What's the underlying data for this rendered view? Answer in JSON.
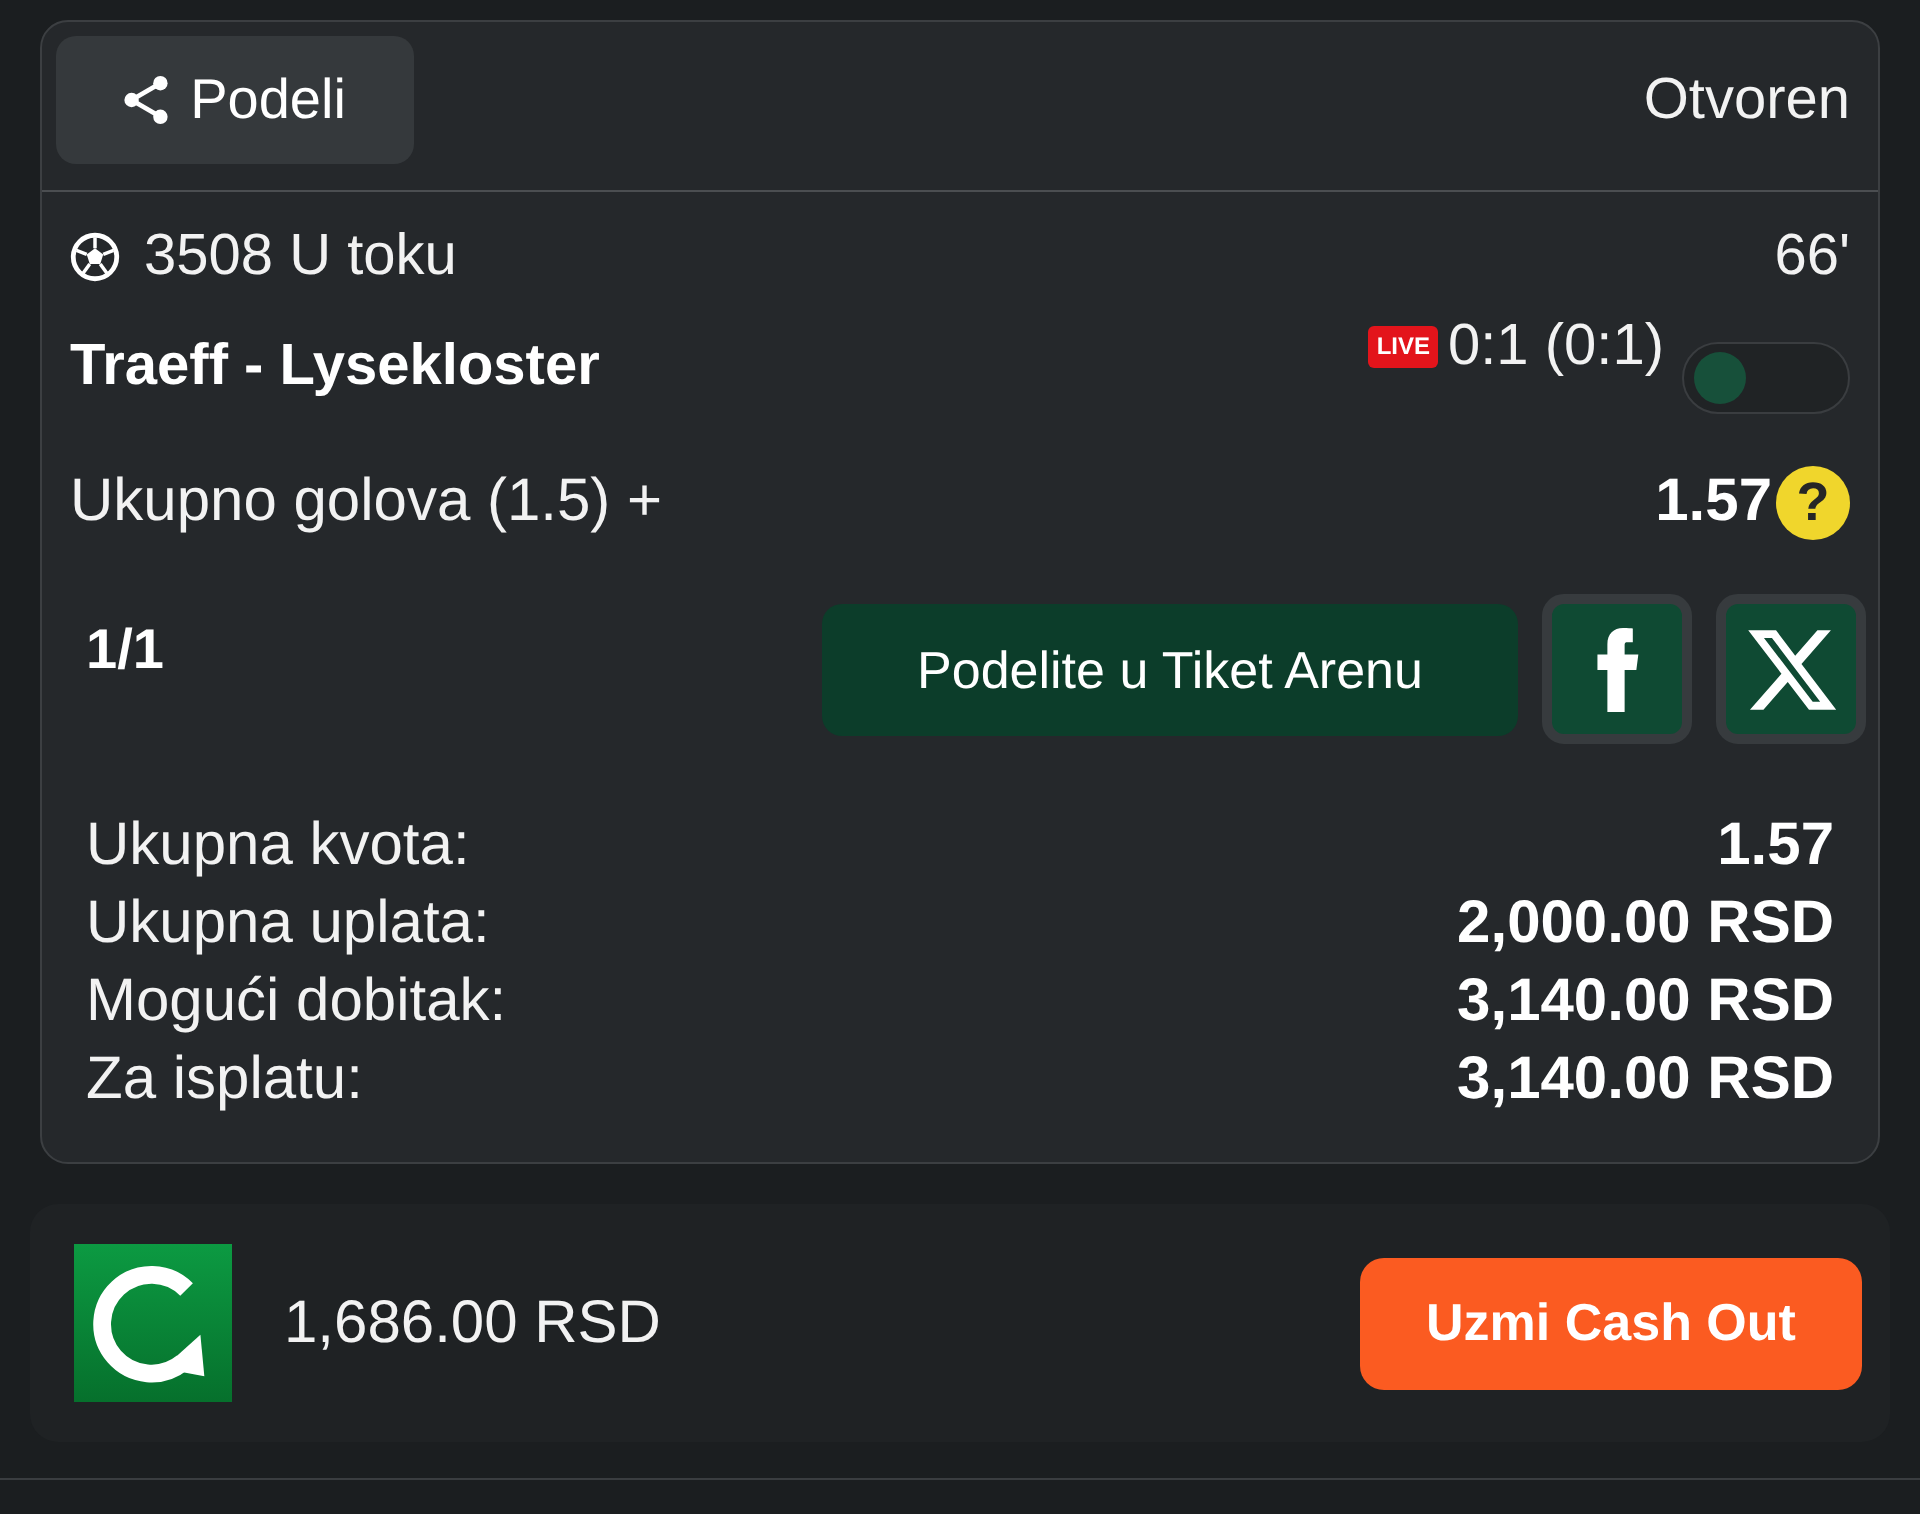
{
  "header": {
    "share_button": "Podeli",
    "status": "Otvoren"
  },
  "event": {
    "title": "3508 U toku",
    "minute": "66'",
    "teams": "Traeff - Lysekloster",
    "live_badge": "LIVE",
    "score": "0:1 (0:1)",
    "toggle": {
      "on": false
    }
  },
  "selection": {
    "market": "Ukupno golova (1.5) +",
    "odds": "1.57",
    "help": "?"
  },
  "ticket": {
    "count": "1/1",
    "arena_button": "Podelite u Tiket Arenu",
    "social_buttons": [
      {
        "kind": "facebook"
      },
      {
        "kind": "x"
      }
    ]
  },
  "summary": [
    {
      "label": "Ukupna kvota:",
      "value": "1.57"
    },
    {
      "label": "Ukupna uplata:",
      "value": "2,000.00 RSD"
    },
    {
      "label": "Mogući dobitak:",
      "value": "3,140.00 RSD"
    },
    {
      "label": "Za isplatu:",
      "value": "3,140.00 RSD"
    }
  ],
  "cash_out": {
    "amount": "1,686.00 RSD",
    "button": "Uzmi Cash Out"
  }
}
